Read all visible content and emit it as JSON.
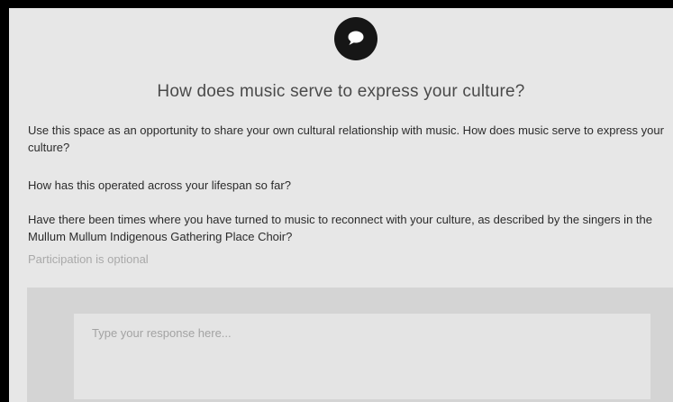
{
  "prompt": {
    "icon": "speech-bubble-icon",
    "question": "How does music serve to express your culture?",
    "paragraphs": [
      "Use this space as an opportunity to share your own cultural relationship with music. How does music serve to express your culture?",
      "How has this operated across your lifespan so far?",
      "Have there been times where you have turned to music to reconnect with your culture, as described by the singers in the Mullum Mullum Indigenous Gathering Place Choir?"
    ],
    "optional_note": "Participation is optional"
  },
  "response": {
    "value": "",
    "placeholder": "Type your response here..."
  },
  "colors": {
    "background": "#e7e7e7",
    "icon_circle": "#161616",
    "response_panel": "#d4d4d4"
  }
}
